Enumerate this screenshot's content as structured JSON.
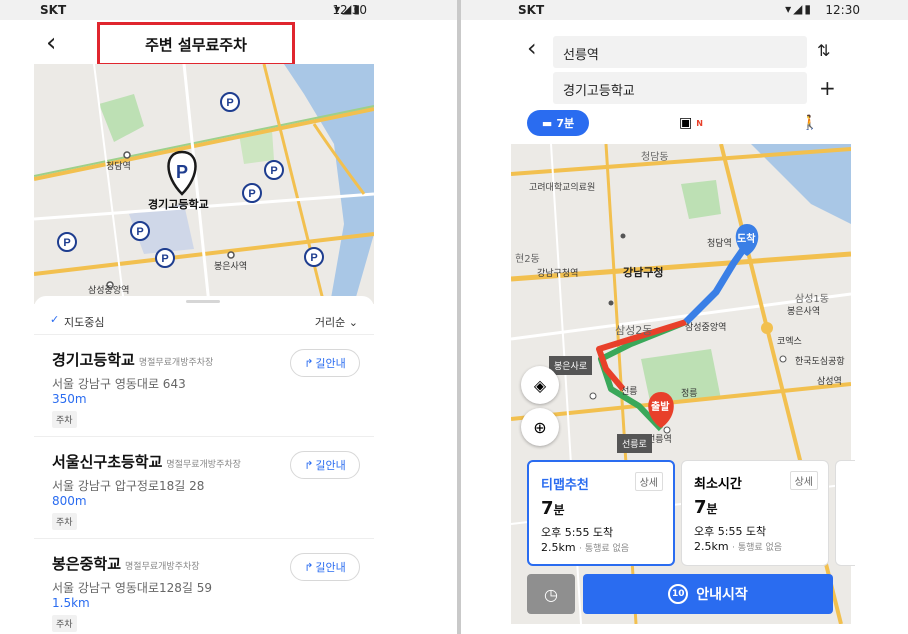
{
  "status_bar": {
    "carrier": "SKT",
    "time": "12:30"
  },
  "left": {
    "header": {
      "title": "주변 설무료주차"
    },
    "map": {
      "center_label": "경기고등학교",
      "labels": [
        "청담역",
        "봉은사역",
        "삼성중앙역"
      ]
    },
    "filter": {
      "center_label": "지도중심",
      "sort_label": "거리순"
    },
    "route_button_label": "길안내",
    "items": [
      {
        "name": "경기고등학교",
        "category": "명절무료개방주차장",
        "address": "서울 강남구 영동대로 643",
        "distance": "350m",
        "tag": "주차"
      },
      {
        "name": "서울신구초등학교",
        "category": "명절무료개방주차장",
        "address": "서울 강남구 압구정로18길 28",
        "distance": "800m",
        "tag": "주차"
      },
      {
        "name": "봉은중학교",
        "category": "명절무료개방주차장",
        "address": "서울 강남구 영동대로128길 59",
        "distance": "1.5km",
        "tag": "주차"
      }
    ]
  },
  "right": {
    "origin": "선릉역",
    "destination": "경기고등학교",
    "modes": {
      "car_time": "7분",
      "transit_badge": "N"
    },
    "map_labels": {
      "dest_pin": "도착",
      "start_pin": "출발",
      "area1": "청담동",
      "area2": "현2동",
      "area3": "삼성2동",
      "area4": "삼성1동",
      "hospital": "고려대학교의료원",
      "cheongdam": "청담역",
      "gangnam_gu": "강남구청",
      "gangnamguoffice_stn": "강남구청역",
      "samseongjungang": "삼성중앙역",
      "bongeunsa": "봉은사역",
      "coex": "코엑스",
      "convention": "한국도심공항",
      "samseong": "삼성역",
      "seolleung": "선릉역",
      "jeongreung": "정릉",
      "seon": "선릉",
      "bongeunsa_road": "봉은사로",
      "seolleung_road": "선릉로"
    },
    "cards": [
      {
        "title": "티맵추천",
        "detail": "상세",
        "minutes": "7",
        "unit": "분",
        "arrival": "오후 5:55 도착",
        "distance": "2.5km",
        "toll": "· 통행료 없음"
      },
      {
        "title": "최소시간",
        "detail": "상세",
        "minutes": "7",
        "unit": "분",
        "arrival": "오후 5:55 도착",
        "distance": "2.5km",
        "toll": "· 통행료 없음"
      }
    ],
    "start_badge": "10",
    "start_label": "안내시작"
  },
  "colors": {
    "accent": "#2a6cf0",
    "highlight": "#e0262e",
    "route_red": "#e8402a",
    "route_green": "#3aa85a"
  }
}
